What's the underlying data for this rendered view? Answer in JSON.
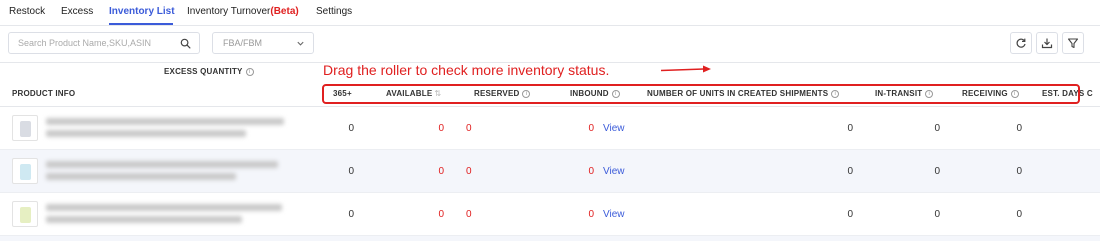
{
  "tabs": [
    {
      "label": "Restock"
    },
    {
      "label": "Excess"
    },
    {
      "label": "Inventory List",
      "active": true
    },
    {
      "label": "Inventory Turnover",
      "suffix": "(Beta)"
    },
    {
      "label": "Settings"
    }
  ],
  "toolbar": {
    "search_placeholder": "Search Product Name,SKU,ASIN",
    "search_icon": "search-icon",
    "fulfillment_select": "FBA/FBM",
    "actions": [
      "refresh-icon",
      "download-icon",
      "filter-icon"
    ]
  },
  "table": {
    "group_header": "EXCESS QUANTITY",
    "columns": {
      "product_info": "PRODUCT INFO",
      "d365": "365+",
      "available": "AVAILABLE",
      "reserved": "RESERVED",
      "inbound": "INBOUND",
      "units_in_created_shipments": "NUMBER OF UNITS IN CREATED SHIPMENTS",
      "in_transit": "IN-TRANSIT",
      "receiving": "RECEIVING",
      "est_days": "EST. DAYS C"
    },
    "rows": [
      {
        "d365": "0",
        "available": "0",
        "reserved": "0",
        "inbound": "0",
        "inbound_link": "View",
        "units_in_created_shipments": "0",
        "in_transit": "0",
        "receiving": "0"
      },
      {
        "d365": "0",
        "available": "0",
        "reserved": "0",
        "inbound": "0",
        "inbound_link": "View",
        "units_in_created_shipments": "0",
        "in_transit": "0",
        "receiving": "0"
      },
      {
        "d365": "0",
        "available": "0",
        "reserved": "0",
        "inbound": "0",
        "inbound_link": "View",
        "units_in_created_shipments": "0",
        "in_transit": "0",
        "receiving": "0"
      }
    ]
  },
  "annotation": {
    "text": "Drag the roller to check more inventory status.",
    "color": "#e02020"
  },
  "colors": {
    "accent": "#3b5bd9",
    "alert": "#e02020"
  }
}
